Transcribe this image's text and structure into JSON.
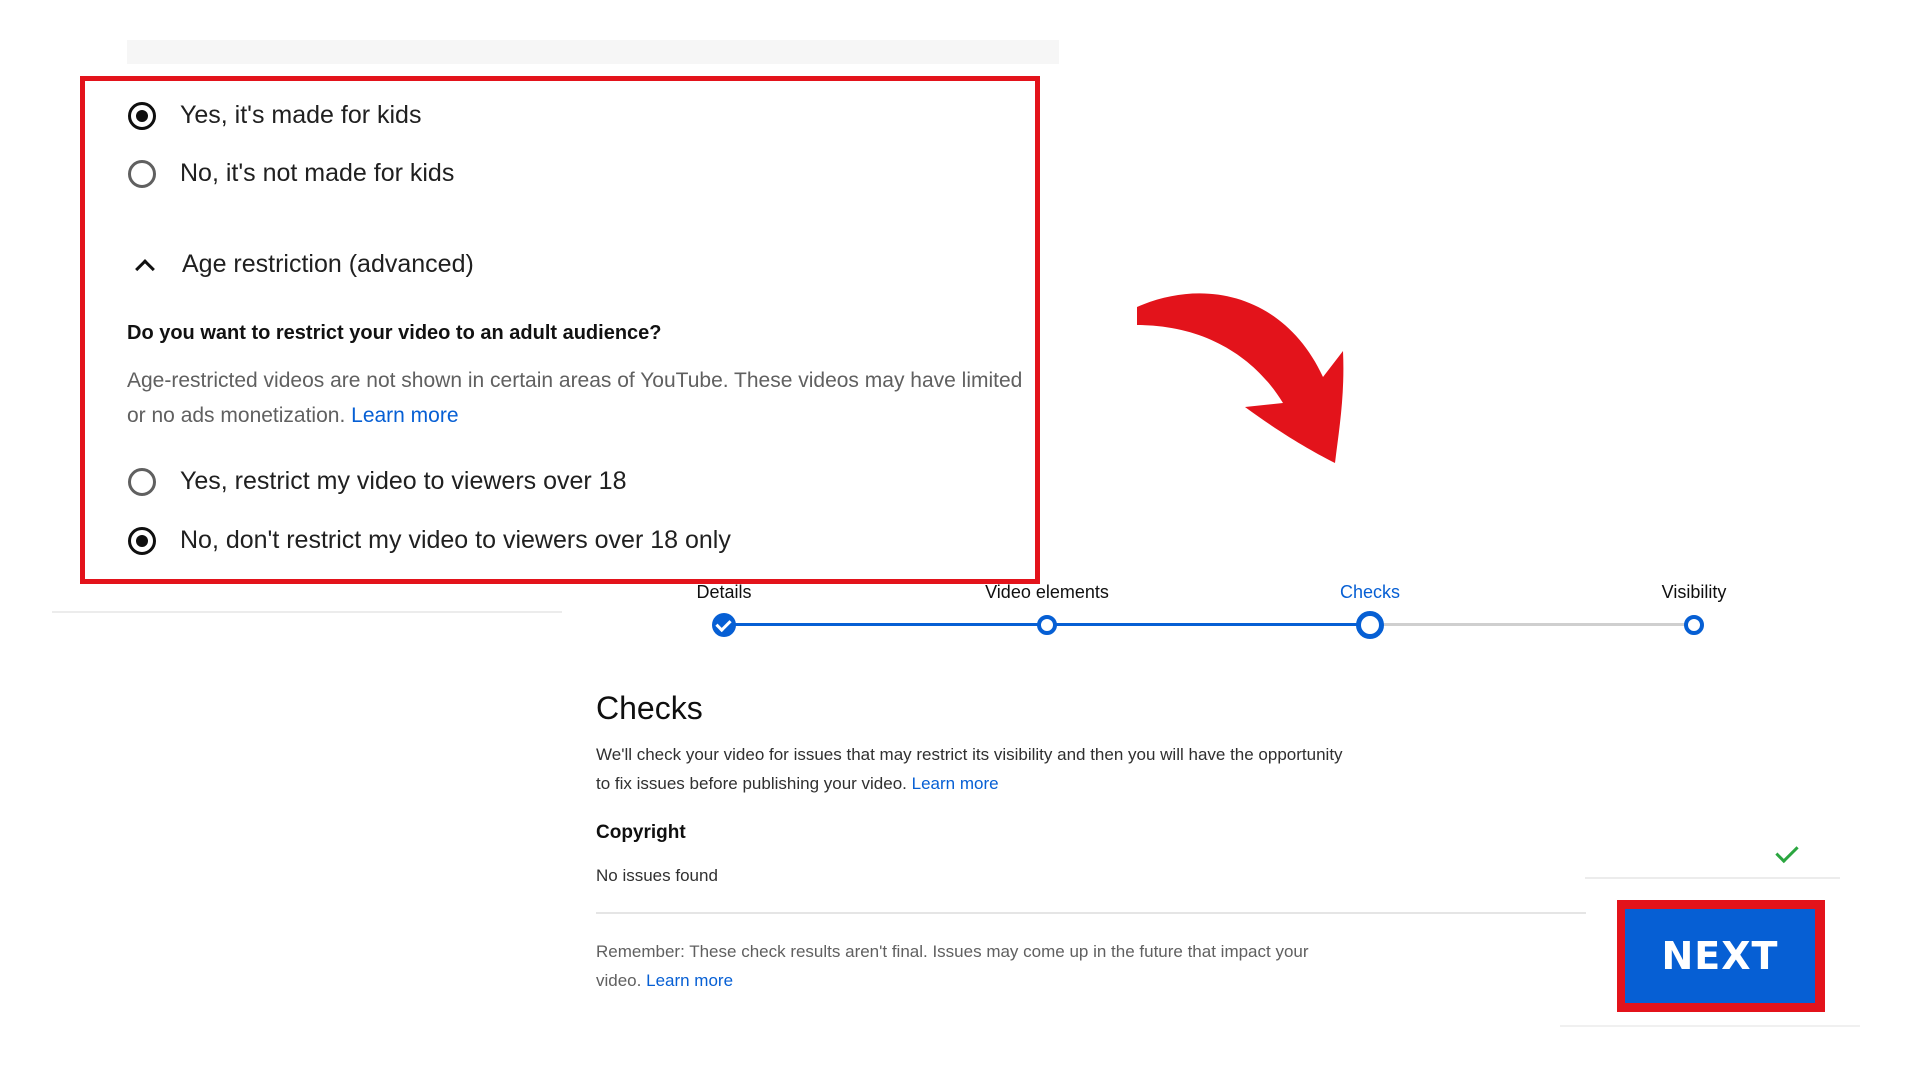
{
  "audience": {
    "options": [
      {
        "label": "Yes, it's made for kids",
        "selected": true
      },
      {
        "label": "No, it's not made for kids",
        "selected": false
      }
    ],
    "age_restriction": {
      "toggle_label": "Age restriction (advanced)",
      "question": "Do you want to restrict your video to an adult audience?",
      "description": "Age-restricted videos are not shown in certain areas of YouTube. These videos may have limited or no ads monetization.",
      "learn_more": "Learn more",
      "options": [
        {
          "label": "Yes, restrict my video to viewers over 18",
          "selected": false
        },
        {
          "label": "No, don't restrict my video to viewers over 18 only",
          "selected": true
        }
      ]
    }
  },
  "stepper": {
    "steps": [
      {
        "label": "Details",
        "state": "done"
      },
      {
        "label": "Video elements",
        "state": "done"
      },
      {
        "label": "Checks",
        "state": "active"
      },
      {
        "label": "Visibility",
        "state": "pending"
      }
    ]
  },
  "checks": {
    "title": "Checks",
    "description": "We'll check your video for issues that may restrict its visibility and then you will have the opportunity to fix issues before publishing your video.",
    "learn_more": "Learn more",
    "copyright_title": "Copyright",
    "copyright_status": "No issues found",
    "remember": "Remember: These check results aren't final. Issues may come up in the future that impact your video.",
    "remember_learn_more": "Learn more"
  },
  "next_button": "NEXT",
  "colors": {
    "accent": "#065fd4",
    "highlight": "#e3131b",
    "success": "#2ba640"
  }
}
